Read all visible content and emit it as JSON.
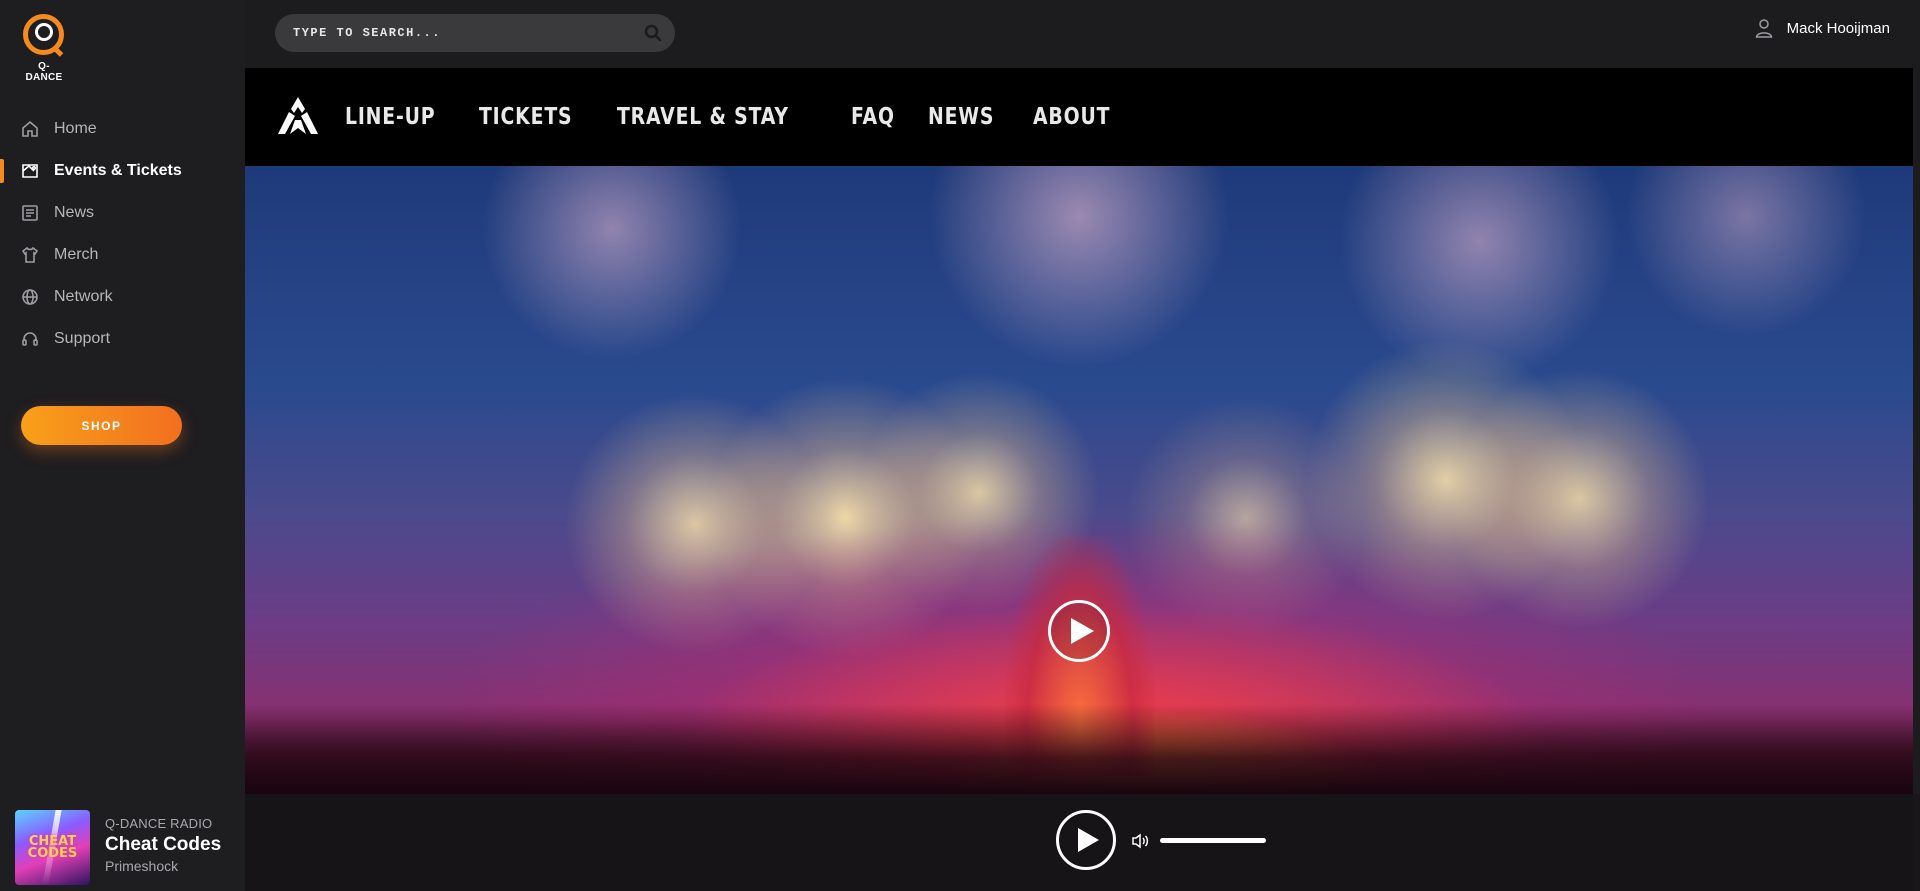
{
  "brand": {
    "wordmark": "Q-DANCE",
    "accent": "#f58a1f"
  },
  "sidebar": {
    "items": [
      {
        "label": "Home",
        "icon": "home-icon",
        "active": false
      },
      {
        "label": "Events & Tickets",
        "icon": "ticket-icon",
        "active": true
      },
      {
        "label": "News",
        "icon": "news-icon",
        "active": false
      },
      {
        "label": "Merch",
        "icon": "shirt-icon",
        "active": false
      },
      {
        "label": "Network",
        "icon": "globe-icon",
        "active": false
      },
      {
        "label": "Support",
        "icon": "headset-icon",
        "active": false
      }
    ],
    "shop_label": "SHOP"
  },
  "search": {
    "placeholder": "TYPE TO SEARCH..."
  },
  "user": {
    "name": "Mack Hooijman"
  },
  "event_nav": {
    "logo": "defqon-logo-icon",
    "links": [
      "LINE-UP",
      "TICKETS",
      "TRAVEL & STAY",
      "FAQ",
      "NEWS",
      "ABOUT"
    ]
  },
  "player": {
    "station": "Q-DANCE RADIO",
    "track": "Cheat Codes",
    "artist": "Primeshock",
    "cover_text": "CHEAT CODES",
    "volume": 1.0
  }
}
